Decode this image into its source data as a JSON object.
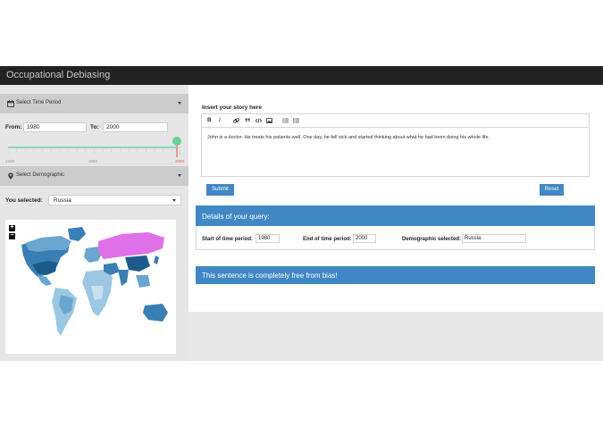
{
  "app": {
    "title": "Occupational Debiasing"
  },
  "sidebar": {
    "time_period": {
      "header": "Select Time Period",
      "from_label": "From:",
      "from_value": "1980",
      "to_label": "To:",
      "to_value": "2000",
      "slider": {
        "min": 1900,
        "max": 2000,
        "tick_labels": [
          "1900",
          "1950",
          "2000"
        ],
        "selected_high": 2000
      }
    },
    "demographic": {
      "header": "Select Demographic",
      "you_selected_label": "You selected:",
      "selected_value": "Russia"
    },
    "map": {
      "zoom_in": "+",
      "zoom_out": "−",
      "highlight_color": "#e070e8",
      "palette": [
        "#1c5a8c",
        "#3a7fb3",
        "#6aa6cf",
        "#9cc7e3",
        "#c9e0ef"
      ]
    }
  },
  "main": {
    "story_label": "Insert your story here",
    "toolbar": [
      "B",
      "I",
      "link-icon",
      "quote-icon",
      "code-icon",
      "image-icon",
      "unordered-list-icon",
      "ordered-list-icon"
    ],
    "story_text": "John is a doctor. He treats his patients well. One day, he fell sick and started thinking about what he had been doing his whole life.",
    "submit_label": "Submit",
    "reset_label": "Reset",
    "details": {
      "header": "Details of your query:",
      "start_label": "Start of time period:",
      "start_value": "1980",
      "end_label": "End of time period:",
      "end_value": "2000",
      "demo_label": "Demographic selected:",
      "demo_value": "Russia"
    },
    "result": "This sentence is completely free from bias!"
  },
  "colors": {
    "accent": "#3f88c5",
    "topbar": "#222222"
  }
}
